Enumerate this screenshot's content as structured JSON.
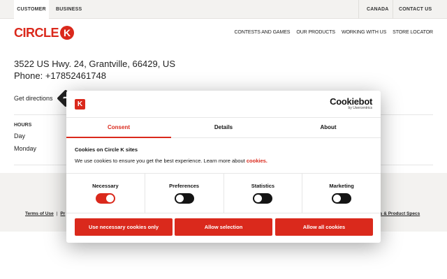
{
  "topbar": {
    "customer": "CUSTOMER",
    "business": "BUSINESS",
    "canada": "CANADA",
    "contact": "CONTACT US"
  },
  "brand": {
    "logo_text": "CIRCLE",
    "logo_k": "K"
  },
  "nav": {
    "items": [
      "CONTESTS AND GAMES",
      "OUR PRODUCTS",
      "WORKING WITH US",
      "STORE LOCATOR"
    ]
  },
  "store": {
    "address": "3522 US Hwy. 24, Grantville, 66429, US",
    "phone": "Phone: +17852461748",
    "directions": "Get directions",
    "hours_title": "HOURS",
    "hours_day": "Day",
    "hours_monday": "Monday"
  },
  "footer": {
    "terms": "Terms of Use",
    "separator": "|",
    "truncated": "Pr",
    "right_link": "ets & Product Specs"
  },
  "cookie": {
    "logo_letter": "K",
    "brand": "Cookiebot",
    "brand_sub": "by Usercentrics",
    "tabs": [
      "Consent",
      "Details",
      "About"
    ],
    "title": "Cookies on Circle K sites",
    "text": "We use cookies to ensure you get the best experience. Learn more about",
    "link": "cookies.",
    "switches": [
      {
        "label": "Necessary",
        "state": "on"
      },
      {
        "label": "Preferences",
        "state": "off"
      },
      {
        "label": "Statistics",
        "state": "off"
      },
      {
        "label": "Marketing",
        "state": "off"
      }
    ],
    "buttons": [
      "Use necessary cookies only",
      "Allow selection",
      "Allow all cookies"
    ],
    "accent": "#da291c"
  }
}
